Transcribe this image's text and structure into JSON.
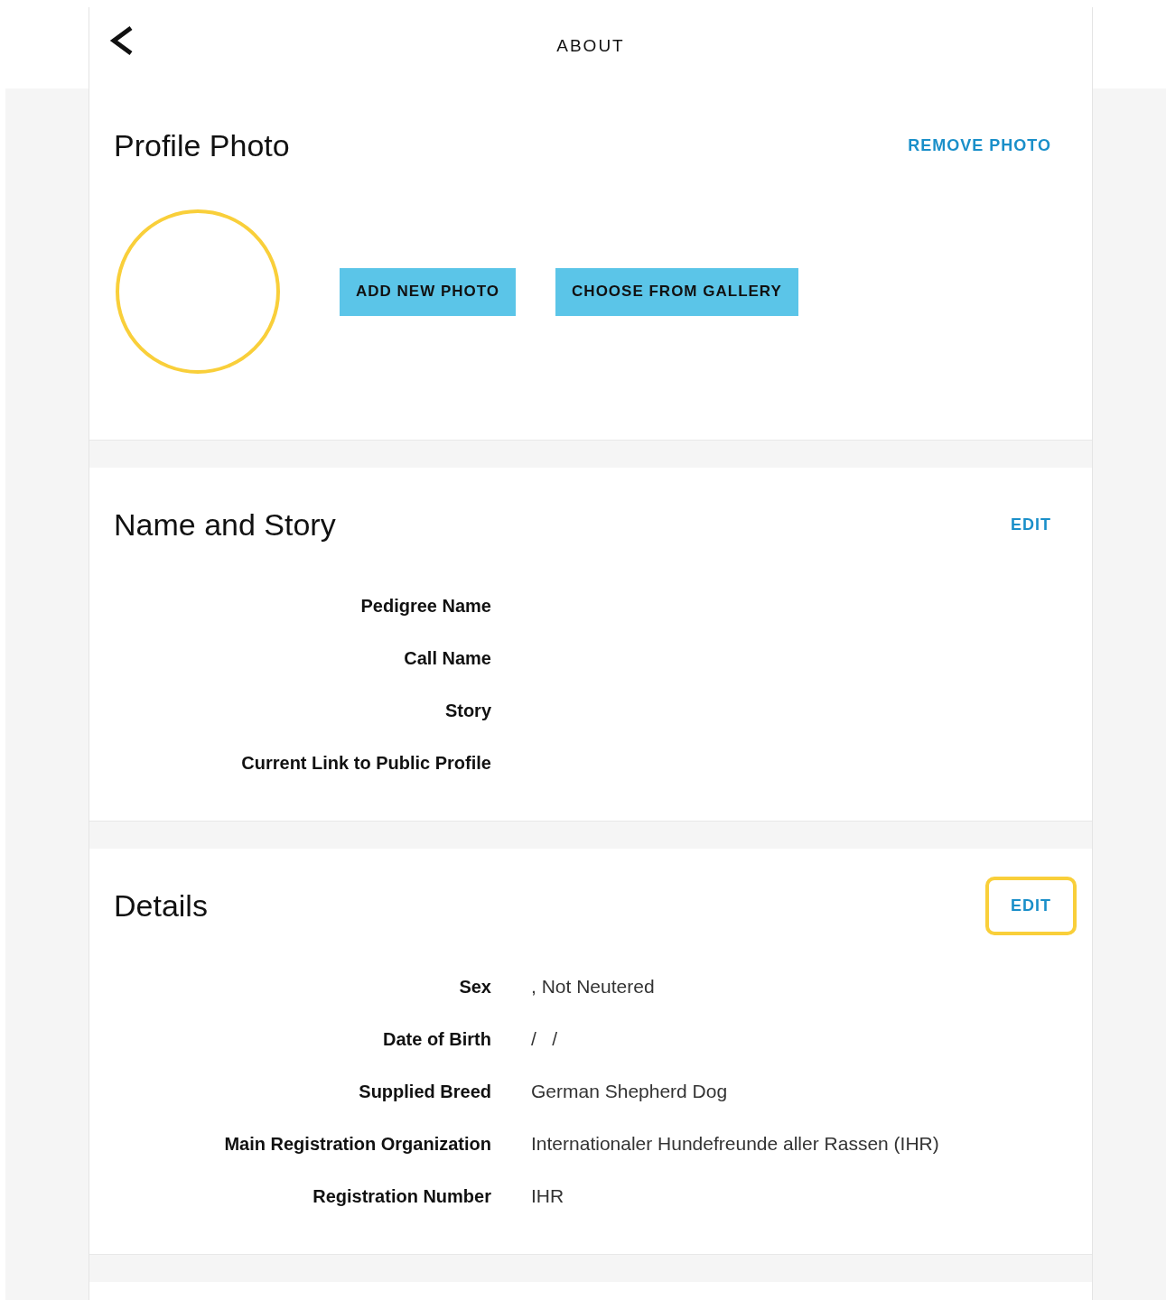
{
  "header": {
    "title": "ABOUT"
  },
  "sections": [
    {
      "kind": "photo",
      "title": "Profile Photo",
      "action": {
        "label": "REMOVE PHOTO",
        "highlighted": false
      },
      "buttons": [
        "ADD NEW PHOTO",
        "CHOOSE FROM GALLERY"
      ]
    },
    {
      "kind": "fields",
      "title": "Name and Story",
      "action": {
        "label": "EDIT",
        "highlighted": false
      },
      "fields": [
        {
          "label": "Pedigree Name"
        },
        {
          "label": "Call Name"
        },
        {
          "label": "Story"
        },
        {
          "label": "Current Link to Public Profile"
        }
      ]
    },
    {
      "kind": "fields",
      "title": "Details",
      "action": {
        "label": "EDIT",
        "highlighted": true
      },
      "fields": [
        {
          "label": "Sex",
          "value": ", Not Neutered"
        },
        {
          "label": "Date of Birth",
          "value": "/   /"
        },
        {
          "label": "Supplied Breed",
          "value": "German Shepherd Dog"
        },
        {
          "label": "Main Registration Organization",
          "value": "Internationaler Hundefreunde aller Rassen (IHR)"
        },
        {
          "label": "Registration Number",
          "value": "IHR"
        }
      ]
    }
  ]
}
